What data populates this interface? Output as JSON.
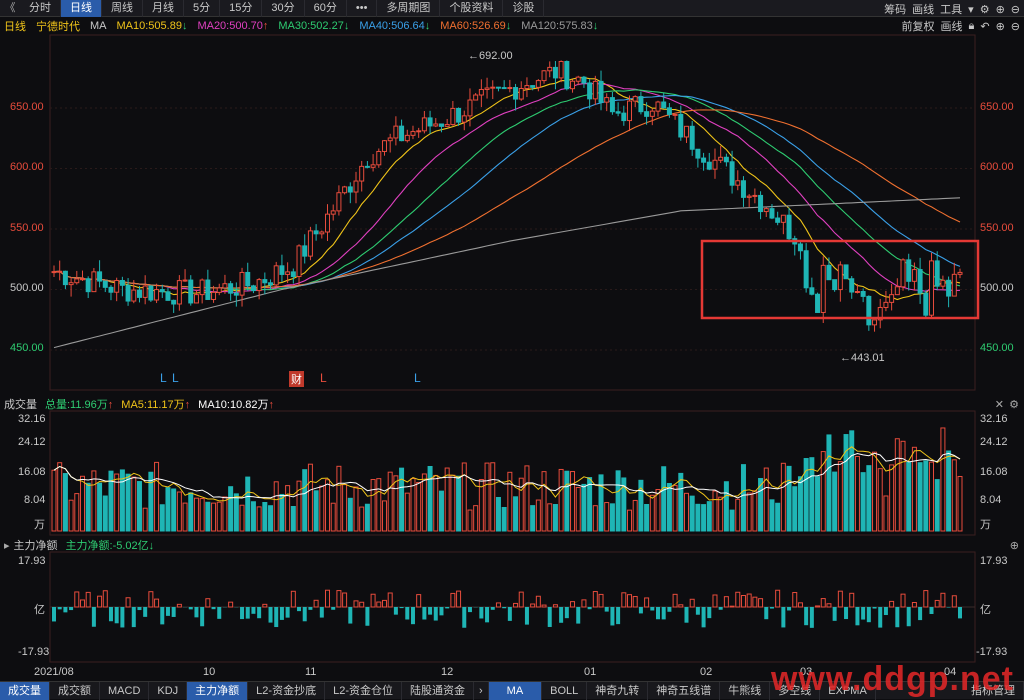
{
  "topbar": {
    "back_glyph": "《",
    "items": [
      {
        "label": "分时",
        "active": false
      },
      {
        "label": "日线",
        "active": true
      },
      {
        "label": "周线",
        "active": false
      },
      {
        "label": "月线",
        "active": false
      },
      {
        "label": "5分",
        "active": false
      },
      {
        "label": "15分",
        "active": false
      },
      {
        "label": "30分",
        "active": false
      },
      {
        "label": "60分",
        "active": false
      },
      {
        "label": "•••",
        "active": false
      },
      {
        "label": "多周期图",
        "active": false
      },
      {
        "label": "个股资料",
        "active": false
      },
      {
        "label": "诊股",
        "active": false
      }
    ],
    "right": [
      "筹码",
      "画线",
      "工具"
    ]
  },
  "infobar": {
    "period": "日线",
    "stock": "宁德时代",
    "ma_label": "MA",
    "ma": [
      {
        "text": "MA10:505.89",
        "arrow": "↓",
        "color": "#f0c419"
      },
      {
        "text": "MA20:500.70",
        "arrow": "↑",
        "color": "#e040c0"
      },
      {
        "text": "MA30:502.27",
        "arrow": "↓",
        "color": "#2ecc71"
      },
      {
        "text": "MA40:506.64",
        "arrow": "↓",
        "color": "#3aa0e8"
      },
      {
        "text": "MA60:526.69",
        "arrow": "↓",
        "color": "#f07030"
      },
      {
        "text": "MA120:575.83",
        "arrow": "↓",
        "color": "#9a9a9a"
      }
    ],
    "right": [
      "前复权",
      "画线"
    ]
  },
  "main_chart": {
    "y_ticks": [
      "650.00",
      "600.00",
      "550.00",
      "500.00",
      "450.00"
    ],
    "high_label": "692.00",
    "low_label": "443.01",
    "signals": [
      {
        "text": "L",
        "color": "#3aa0e8"
      },
      {
        "text": "L",
        "color": "#3aa0e8"
      },
      {
        "text": "财",
        "color": "#ffffff"
      },
      {
        "text": "L",
        "color": "#e74c3c"
      },
      {
        "text": "L",
        "color": "#3aa0e8"
      }
    ]
  },
  "volume_panel": {
    "title": "成交量",
    "total": "总量:11.96万",
    "total_arrow": "↑",
    "ma5": "MA5:11.17万",
    "ma5_arrow": "↑",
    "ma10": "MA10:10.82万",
    "ma10_arrow": "↑",
    "y_ticks": [
      "32.16",
      "24.12",
      "16.08",
      "8.04"
    ],
    "unit": "万"
  },
  "flow_panel": {
    "title": "主力净额",
    "value": "主力净额:-5.02亿",
    "value_arrow": "↓",
    "y_top": "17.93",
    "y_mid": "亿",
    "y_bottom": "-17.93"
  },
  "x_axis": [
    "2021/08",
    "10",
    "11",
    "12",
    "01",
    "02",
    "03",
    "04"
  ],
  "bottom_tabs": [
    {
      "label": "成交量",
      "active": true
    },
    {
      "label": "成交额",
      "active": false
    },
    {
      "label": "MACD",
      "active": false
    },
    {
      "label": "KDJ",
      "active": false
    },
    {
      "label": "主力净额",
      "active": true
    },
    {
      "label": "L2-资金抄底",
      "active": false
    },
    {
      "label": "L2-资金仓位",
      "active": false
    },
    {
      "label": "陆股通资金",
      "active": false
    },
    {
      "label": "MA",
      "active": true
    },
    {
      "label": "BOLL",
      "active": false
    },
    {
      "label": "神奇九转",
      "active": false
    },
    {
      "label": "神奇五线谱",
      "active": false
    },
    {
      "label": "牛熊线",
      "active": false
    },
    {
      "label": "多空线",
      "active": false
    },
    {
      "label": "EXPMA",
      "active": false
    },
    {
      "label": "指标管理",
      "active": false
    }
  ],
  "watermark": "www.ddgp.net",
  "colors": {
    "up": "#e74c3c",
    "down": "#1fb5b5",
    "highlight_box": "#e53935"
  }
}
